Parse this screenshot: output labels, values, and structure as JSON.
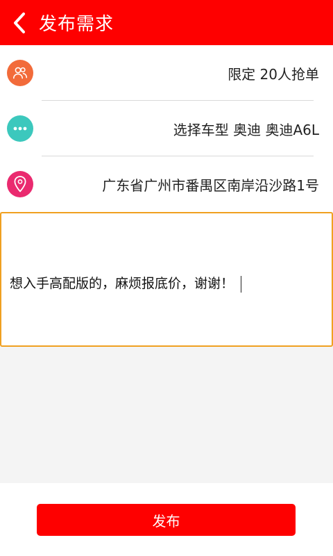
{
  "header": {
    "title": "发布需求",
    "back_icon": "chevron-left-icon"
  },
  "rows": [
    {
      "icon": "users-icon",
      "value": "限定 20人抢单",
      "color": "#f26b3a"
    },
    {
      "icon": "more-dots-icon",
      "value": "选择车型  奥迪 奥迪A6L",
      "color": "#3cc8bd"
    },
    {
      "icon": "location-pin-icon",
      "value": "广东省广州市番禺区南岸沿沙路1号",
      "color": "#ea2a6f"
    }
  ],
  "textarea": {
    "value": "想入手高配版的，麻烦报底价，谢谢！"
  },
  "footer": {
    "publish_label": "发布"
  },
  "colors": {
    "brand_red": "#fe0000",
    "focus_border": "#f0a020"
  }
}
